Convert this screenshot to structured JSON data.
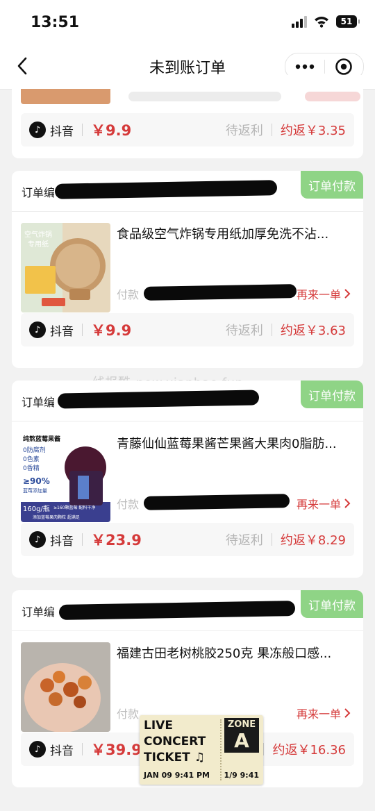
{
  "status_bar": {
    "time": "13:51",
    "battery": "51"
  },
  "nav": {
    "title": "未到账订单"
  },
  "watermark": "线报酷-new.xianbao.fun",
  "common": {
    "order_label": "订单编",
    "pay_badge": "订单付款",
    "pay_time_label": "付款",
    "again_label": "再来一单",
    "platform": "抖音",
    "status": "待返利",
    "rebate_prefix": "约返"
  },
  "orders": [
    {
      "price": "￥9.9",
      "rebate": "￥3.35"
    },
    {
      "title": "食品级空气炸锅专用纸加厚免洗不沾...",
      "price": "￥9.9",
      "rebate": "￥3.63",
      "thumb_text": [
        "空气炸锅",
        "专用纸"
      ]
    },
    {
      "title": "青藤仙仙蓝莓果酱芒果酱大果肉0脂肪...",
      "price": "￥23.9",
      "rebate": "￥8.29",
      "thumb_text": [
        "纯熬蓝莓果酱",
        "0防腐剂",
        "0色素",
        "0香精",
        "≥90%",
        "蓝莓添加量",
        "160g/瓶",
        "≥160颗蓝莓 配料干净",
        "添加蓝莓果肉颗粒 超满足"
      ]
    },
    {
      "title": "福建古田老树桃胶250克 果冻般口感...",
      "price": "￥39.9",
      "rebate": "￥16.36"
    }
  ],
  "ticket": {
    "line1": "LIVE",
    "line2": "CONCERT",
    "line3": "TICKET ♫",
    "zone_label": "ZONE",
    "zone_letter": "A",
    "date": "JAN 09   9:41 PM",
    "number": "1/9   9:41"
  }
}
